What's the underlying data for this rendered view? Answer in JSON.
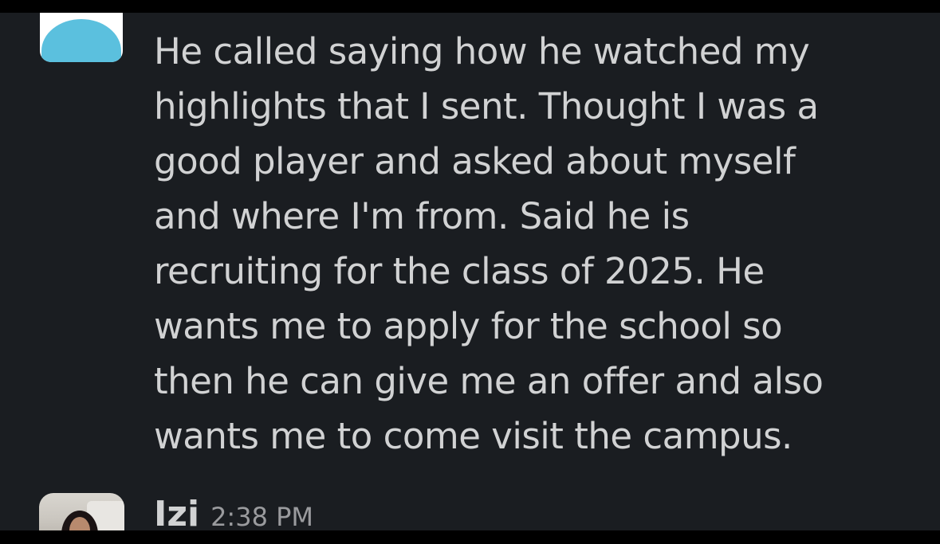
{
  "messages": [
    {
      "text": "He called saying how he watched my\nhighlights that I sent. Thought I was a\ngood player and asked about myself\nand where I'm from. Said he is\nrecruiting for the class of 2025. He\nwants me to apply for the school so\nthen he can give me an offer and also\nwants me to come visit the campus.",
      "avatar_icon": "default-user-avatar-icon"
    },
    {
      "sender": "Izi",
      "time": "2:38 PM",
      "avatar_icon": "user-photo-avatar"
    }
  ],
  "colors": {
    "background": "#1a1d21",
    "text": "#d1d2d3",
    "timestamp": "#9a9b9e",
    "avatar_accent": "#5bc0de"
  }
}
